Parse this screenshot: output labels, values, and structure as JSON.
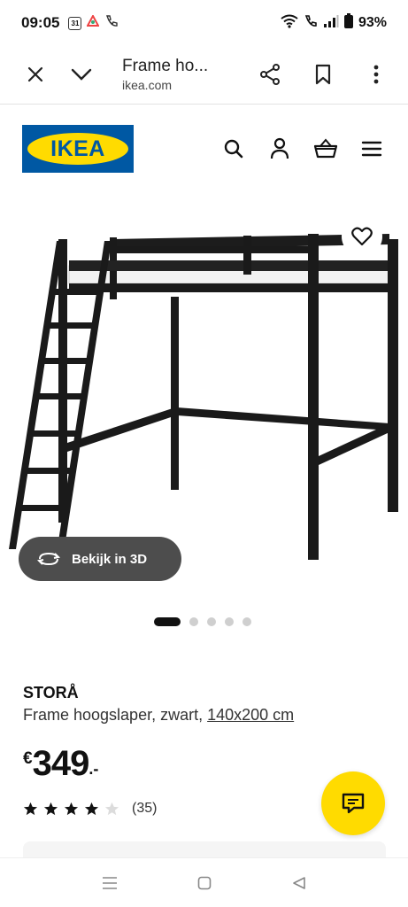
{
  "status": {
    "time": "09:05",
    "calendar_day": "31",
    "battery": "93%"
  },
  "browser": {
    "title": "Frame ho...",
    "url": "ikea.com",
    "icons": [
      "close-icon",
      "chevron-down-icon",
      "share-icon",
      "bookmark-icon",
      "more-vert-icon"
    ]
  },
  "header": {
    "logo_text": "IKEA",
    "icons": [
      "search-icon",
      "user-icon",
      "basket-icon",
      "menu-icon"
    ],
    "brand_blue": "#0058a3",
    "brand_yellow": "#ffdb00"
  },
  "gallery": {
    "view3d_label": "Bekijk in 3D",
    "image_count": 5,
    "active_index": 0
  },
  "product": {
    "name": "STORÅ",
    "description": "Frame hoogslaper, zwart,",
    "size_link": "140x200 cm",
    "currency": "€",
    "price_int": "349",
    "price_dec": ".-",
    "rating_stars": 4,
    "rating_max": 5,
    "review_count": "(35)"
  }
}
